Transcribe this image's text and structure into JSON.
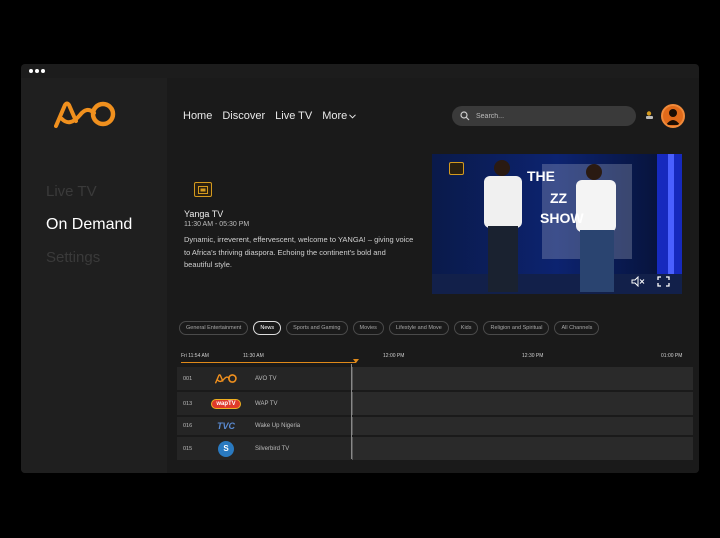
{
  "sidebar": {
    "logo_text": "AO",
    "items": [
      {
        "label": "Live TV",
        "active": false
      },
      {
        "label": "On  Demand",
        "active": true
      },
      {
        "label": "Settings",
        "active": false
      }
    ]
  },
  "topnav": {
    "items": [
      "Home",
      "Discover",
      "Live TV"
    ],
    "more_label": "More"
  },
  "search": {
    "placeholder": "Search..."
  },
  "featured": {
    "channel_name": "Yanga TV",
    "time": "11:30 AM - 05:30 PM",
    "description": "Dynamic, irreverent, effervescent, welcome to YANGA! – giving voice to Africa's thriving diaspora. Echoing the continent's bold and beautiful style."
  },
  "player": {
    "sign_text_1": "THE",
    "sign_text_2": "ZZ",
    "sign_text_3": "SHOW"
  },
  "filters": [
    {
      "label": "General Entertainment",
      "active": false
    },
    {
      "label": "News",
      "active": true
    },
    {
      "label": "Sports and Gaming",
      "active": false
    },
    {
      "label": "Movies",
      "active": false
    },
    {
      "label": "Lifestyle and Move",
      "active": false
    },
    {
      "label": "Kids",
      "active": false
    },
    {
      "label": "Religion and Spiritual",
      "active": false
    },
    {
      "label": "All Channels",
      "active": false
    }
  ],
  "timeline": {
    "current": "Fri 11:54 AM",
    "slots": [
      "11:30 AM",
      "12:00 PM",
      "12:30 PM",
      "01:00 PM"
    ]
  },
  "guide": [
    {
      "number": "001",
      "logo": "AO",
      "name": "AVO TV"
    },
    {
      "number": "013",
      "logo": "wapTV",
      "name": "WAP TV"
    },
    {
      "number": "016",
      "logo": "TVC",
      "name": "Wake Up Nigeria"
    },
    {
      "number": "015",
      "logo": "S",
      "name": "Silverbird TV"
    }
  ],
  "colors": {
    "accent": "#e08a1a",
    "logo_orange": "#f0901e",
    "background": "#1a1a1a",
    "sidebar": "#1f1f1f"
  }
}
